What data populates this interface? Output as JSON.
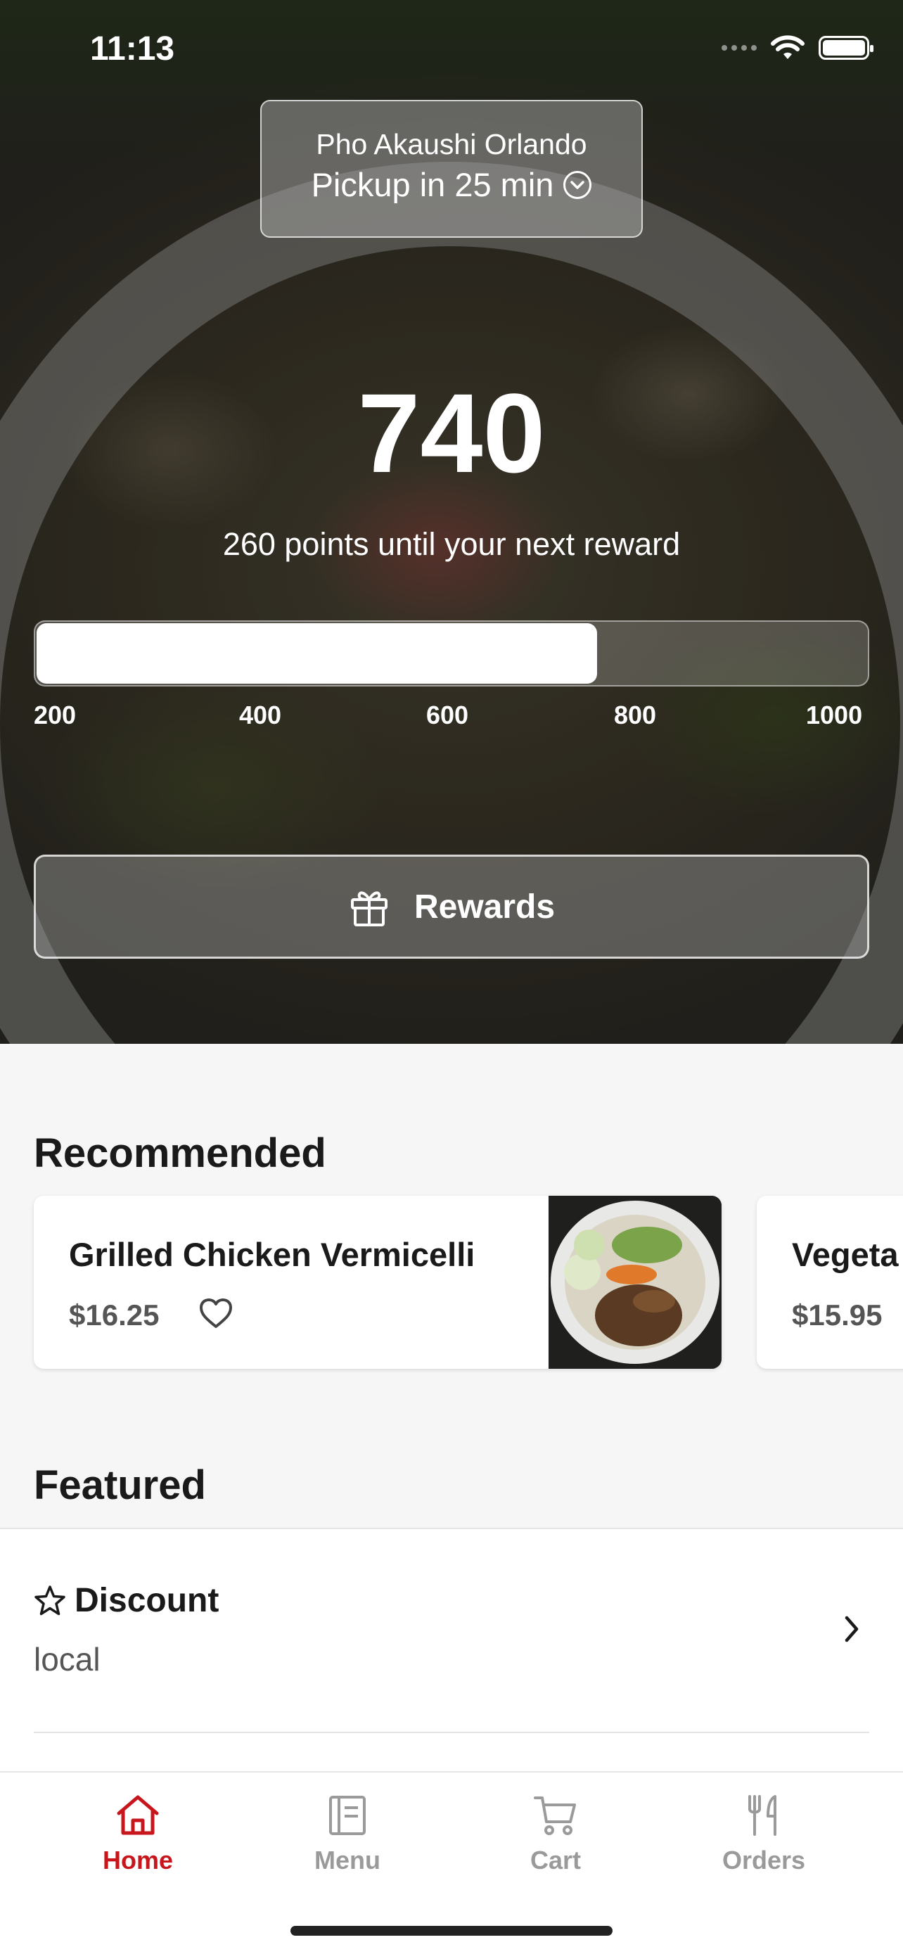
{
  "status_bar": {
    "time": "11:13"
  },
  "location": {
    "store_name": "Pho Akaushi Orlando",
    "pickup_text": "Pickup in 25 min"
  },
  "loyalty": {
    "points": "740",
    "subtitle": "260 points until your next reward",
    "progress_fraction": 0.675,
    "ticks": [
      "200",
      "400",
      "600",
      "800",
      "1000"
    ],
    "rewards_label": "Rewards"
  },
  "recommended": {
    "title": "Recommended",
    "items": [
      {
        "name": "Grilled Chicken Vermicelli",
        "price": "$16.25"
      },
      {
        "name": "Vegeta",
        "price": "$15.95"
      }
    ]
  },
  "featured": {
    "title": "Featured",
    "items": [
      {
        "title": "Discount",
        "subtitle": "local"
      }
    ]
  },
  "tabs": [
    {
      "label": "Home",
      "active": true
    },
    {
      "label": "Menu",
      "active": false
    },
    {
      "label": "Cart",
      "active": false
    },
    {
      "label": "Orders",
      "active": false
    }
  ],
  "colors": {
    "accent": "#c8161d",
    "inactive_tab": "#9a9a9a"
  }
}
